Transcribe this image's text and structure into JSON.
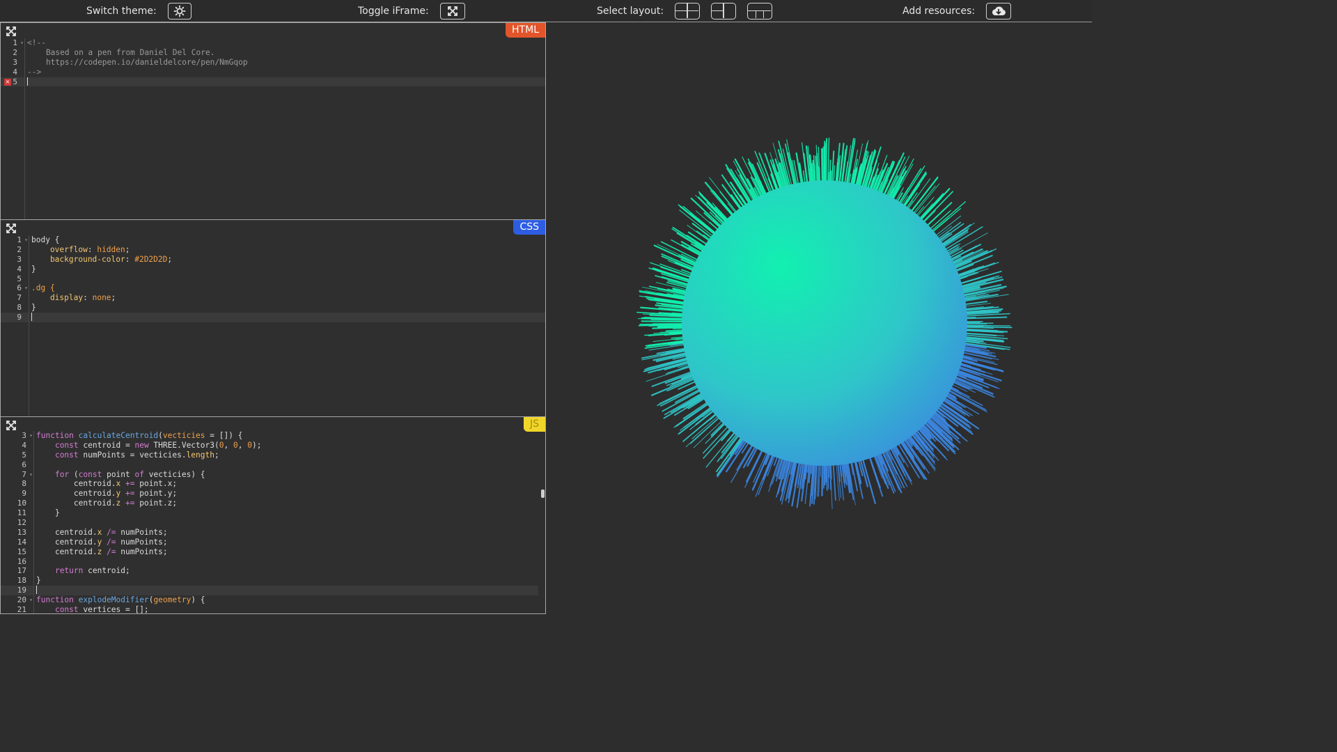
{
  "toolbar": {
    "switch_theme_label": "Switch theme:",
    "toggle_iframe_label": "Toggle iFrame:",
    "select_layout_label": "Select layout:",
    "add_resources_label": "Add resources:"
  },
  "html_pane": {
    "badge": "HTML",
    "badge_color": "#e2552b",
    "lines": [
      {
        "num": "1",
        "text": "<!--"
      },
      {
        "num": "2",
        "text": "    Based on a pen from Daniel Del Core."
      },
      {
        "num": "3",
        "text": "    https://codepen.io/danieldelcore/pen/NmGqop"
      },
      {
        "num": "4",
        "text": "-->"
      },
      {
        "num": "5",
        "text": ""
      }
    ]
  },
  "css_pane": {
    "badge": "CSS",
    "badge_color": "#2d5de3",
    "lines": [
      {
        "num": "1",
        "text": "body {"
      },
      {
        "num": "2",
        "text": "    overflow: hidden;"
      },
      {
        "num": "3",
        "text": "    background-color: #2D2D2D;"
      },
      {
        "num": "4",
        "text": "}"
      },
      {
        "num": "5",
        "text": ""
      },
      {
        "num": "6",
        "text": ".dg {"
      },
      {
        "num": "7",
        "text": "    display: none;"
      },
      {
        "num": "8",
        "text": "}"
      },
      {
        "num": "9",
        "text": ""
      }
    ]
  },
  "js_pane": {
    "badge": "JS",
    "badge_color": "#f1d62a",
    "lines": [
      {
        "num": "3",
        "text": "function calculateCentroid(vecticies = []) {"
      },
      {
        "num": "4",
        "text": "    const centroid = new THREE.Vector3(0, 0, 0);"
      },
      {
        "num": "5",
        "text": "    const numPoints = vecticies.length;"
      },
      {
        "num": "6",
        "text": ""
      },
      {
        "num": "7",
        "text": "    for (const point of vecticies) {"
      },
      {
        "num": "8",
        "text": "        centroid.x += point.x;"
      },
      {
        "num": "9",
        "text": "        centroid.y += point.y;"
      },
      {
        "num": "10",
        "text": "        centroid.z += point.z;"
      },
      {
        "num": "11",
        "text": "    }"
      },
      {
        "num": "12",
        "text": ""
      },
      {
        "num": "13",
        "text": "    centroid.x /= numPoints;"
      },
      {
        "num": "14",
        "text": "    centroid.y /= numPoints;"
      },
      {
        "num": "15",
        "text": "    centroid.z /= numPoints;"
      },
      {
        "num": "16",
        "text": ""
      },
      {
        "num": "17",
        "text": "    return centroid;"
      },
      {
        "num": "18",
        "text": "}"
      },
      {
        "num": "19",
        "text": ""
      },
      {
        "num": "20",
        "text": "function explodeModifier(geometry) {"
      },
      {
        "num": "21",
        "text": "    const vertices = [];"
      }
    ]
  },
  "preview": {
    "background": "#2D2D2D",
    "ball_colors": [
      "#12f0b0",
      "#2fc6c9",
      "#3b86e0"
    ]
  }
}
